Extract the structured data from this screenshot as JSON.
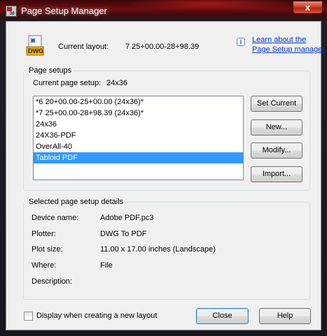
{
  "window": {
    "title": "Page Setup Manager",
    "app_icon_text": "30",
    "close_label": "x"
  },
  "header": {
    "icon_text": "DWG",
    "current_layout_label": "Current layout:",
    "current_layout_value": "7 25+00.00-28+98.39",
    "info_icon": "i",
    "learn_link_line1": "Learn about the",
    "learn_link_line2": "Page Setup manager"
  },
  "page_setups": {
    "group_title": "Page setups",
    "current_label": "Current page setup:",
    "current_value": "24x36",
    "items": [
      "*6 20+00.00-25+00.00 (24x36)*",
      "*7 25+00.00-28+98.39 (24x36)*",
      "24x36",
      "24X36-PDF",
      "OverAll-40",
      "Tabloid PDF"
    ],
    "selected_index": 5,
    "buttons": {
      "set_current": "Set Current",
      "new": "New...",
      "modify": "Modify...",
      "import": "Import..."
    }
  },
  "details": {
    "group_title": "Selected page setup details",
    "device_name_label": "Device name:",
    "device_name_value": "Adobe PDF.pc3",
    "plotter_label": "Plotter:",
    "plotter_value": "DWG To PDF",
    "plot_size_label": "Plot size:",
    "plot_size_value": "11.00 x 17.00 inches (Landscape)",
    "where_label": "Where:",
    "where_value": "File",
    "description_label": "Description:",
    "description_value": ""
  },
  "footer": {
    "checkbox_label": "Display when creating a new layout",
    "checkbox_checked": false,
    "close_button": "Close",
    "help_button": "Help"
  }
}
